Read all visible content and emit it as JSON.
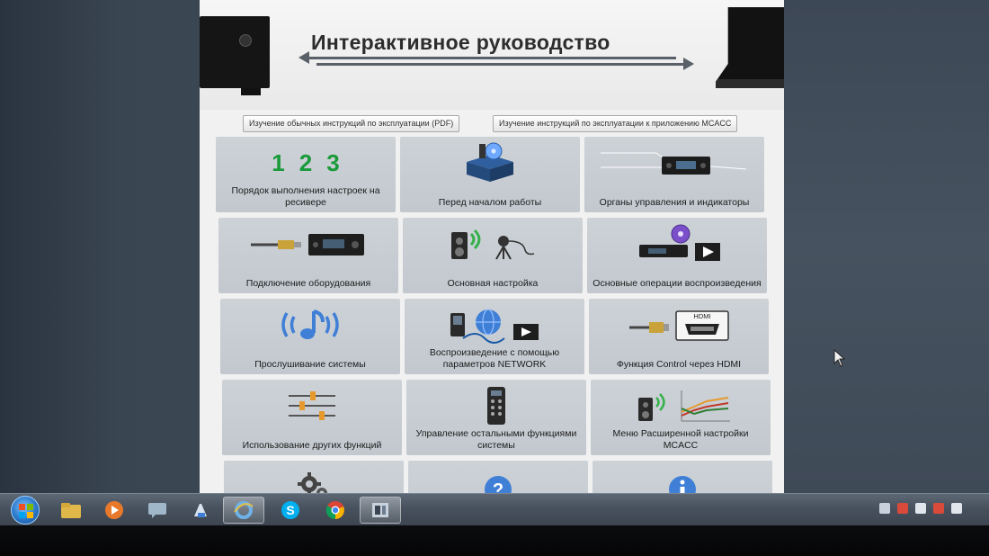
{
  "app": {
    "title": "Интерактивное руководство",
    "buttons": {
      "pdf": "Изучение обычных инструкций по эксплуатации (PDF)",
      "mcacc": "Изучение инструкций по эксплуатации к приложению MCACC"
    },
    "tiles": [
      {
        "label": "Порядок выполнения настроек на ресивере",
        "icon": "numbers-123-icon",
        "digits": [
          "1",
          "2",
          "3"
        ]
      },
      {
        "label": "Перед началом работы",
        "icon": "box-with-disc-icon"
      },
      {
        "label": "Органы управления и индикаторы",
        "icon": "receiver-front-panel-icon"
      },
      {
        "label": "Подключение оборудования",
        "icon": "cable-to-receiver-icon"
      },
      {
        "label": "Основная настройка",
        "icon": "speaker-microphone-icon"
      },
      {
        "label": "Основные операции воспроизведения",
        "icon": "disc-player-play-icon"
      },
      {
        "label": "Прослушивание системы",
        "icon": "surround-music-note-icon"
      },
      {
        "label": "Воспроизведение с помощью параметров NETWORK",
        "icon": "network-globe-play-icon"
      },
      {
        "label": "Функция Control через HDMI",
        "icon": "hdmi-plug-icon",
        "badge": "HDMI"
      },
      {
        "label": "Использование других функций",
        "icon": "equalizer-sliders-icon"
      },
      {
        "label": "Управление остальными функциями системы",
        "icon": "remote-control-icon"
      },
      {
        "label": "Меню Расширенной настройки MCACC",
        "icon": "speaker-graph-icon"
      },
      {
        "label": "",
        "icon": "gears-icon"
      },
      {
        "label": "",
        "icon": "question-mark-icon"
      },
      {
        "label": "",
        "icon": "info-icon"
      }
    ]
  },
  "taskbar": {
    "items": [
      "start-icon",
      "explorer-folder-icon",
      "media-player-icon",
      "chat-icon",
      "paint-icon",
      "ie-browser-icon",
      "skype-icon",
      "chrome-icon",
      "receiver-app-icon"
    ],
    "active_index": 4
  },
  "colors": {
    "tile_bg": "#c6ccd2",
    "accent_blue": "#3f7fd6",
    "digits_green": "#1a9a3a",
    "window_bg": "#f1f1f1"
  }
}
